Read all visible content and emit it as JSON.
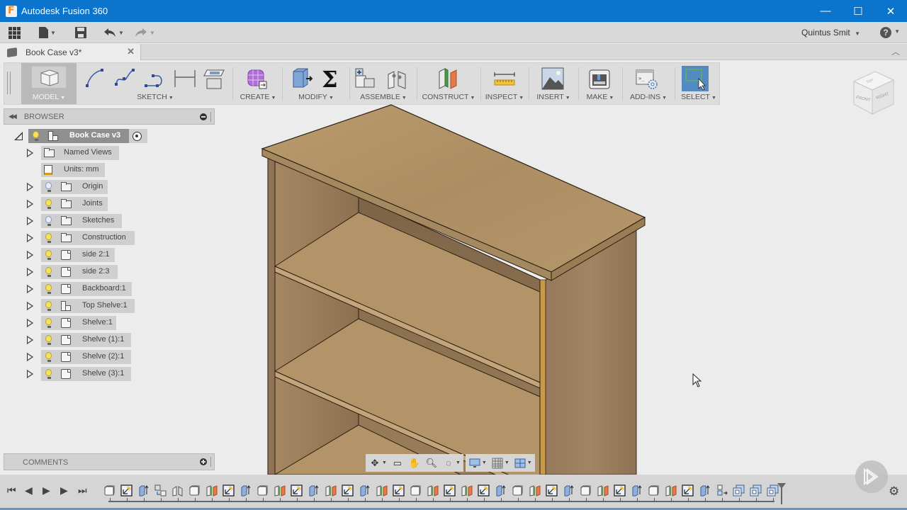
{
  "window": {
    "app_title": "Autodesk Fusion 360",
    "controls": {
      "minimize": "—",
      "maximize": "☐",
      "close": "✕"
    }
  },
  "quick_access": {
    "icons": [
      "apps-grid-icon",
      "file-icon",
      "save-icon",
      "undo-icon",
      "redo-icon"
    ],
    "user_name": "Quintus Smit",
    "help_glyph": "?"
  },
  "document_tab": {
    "label": "Book Case v3*",
    "close_glyph": "✕"
  },
  "ribbon": {
    "workspace": "MODEL",
    "groups": [
      {
        "label": "SKETCH",
        "tools": [
          "arc-icon",
          "spline-icon",
          "line-icon",
          "dimension-icon",
          "stop-sketch-icon"
        ]
      },
      {
        "label": "CREATE",
        "tools": [
          "create-form-icon"
        ]
      },
      {
        "label": "MODIFY",
        "tools": [
          "press-pull-icon",
          "parameters-icon"
        ]
      },
      {
        "label": "ASSEMBLE",
        "tools": [
          "new-component-icon",
          "joint-icon"
        ]
      },
      {
        "label": "CONSTRUCT",
        "tools": [
          "offset-plane-icon"
        ]
      },
      {
        "label": "INSPECT",
        "tools": [
          "measure-icon"
        ]
      },
      {
        "label": "INSERT",
        "tools": [
          "insert-image-icon"
        ]
      },
      {
        "label": "MAKE",
        "tools": [
          "3d-print-icon"
        ]
      },
      {
        "label": "ADD-INS",
        "tools": [
          "scripts-icon"
        ]
      },
      {
        "label": "SELECT",
        "tools": [
          "window-select-icon"
        ]
      }
    ],
    "caret": "▼"
  },
  "browser": {
    "title": "BROWSER",
    "root": "Book Case v3",
    "items": [
      {
        "label": "Named Views",
        "icon": "folder",
        "bulb": "none",
        "expandable": true
      },
      {
        "label": "Units: mm",
        "icon": "units",
        "bulb": "none",
        "expandable": false
      },
      {
        "label": "Origin",
        "icon": "folder",
        "bulb": "off",
        "expandable": true
      },
      {
        "label": "Joints",
        "icon": "folder",
        "bulb": "on",
        "expandable": true
      },
      {
        "label": "Sketches",
        "icon": "folder",
        "bulb": "off",
        "expandable": true
      },
      {
        "label": "Construction",
        "icon": "folder",
        "bulb": "on",
        "expandable": true
      },
      {
        "label": "side 2:1",
        "icon": "body",
        "bulb": "on",
        "expandable": true
      },
      {
        "label": "side 2:3",
        "icon": "body",
        "bulb": "on",
        "expandable": true
      },
      {
        "label": "Backboard:1",
        "icon": "body",
        "bulb": "on",
        "expandable": true
      },
      {
        "label": "Top Shelve:1",
        "icon": "component",
        "bulb": "on",
        "expandable": true
      },
      {
        "label": "Shelve:1",
        "icon": "body",
        "bulb": "on",
        "expandable": true
      },
      {
        "label": "Shelve (1):1",
        "icon": "body",
        "bulb": "on",
        "expandable": true
      },
      {
        "label": "Shelve (2):1",
        "icon": "body",
        "bulb": "on",
        "expandable": true
      },
      {
        "label": "Shelve (3):1",
        "icon": "body",
        "bulb": "on",
        "expandable": true
      }
    ]
  },
  "comments": {
    "title": "COMMENTS"
  },
  "viewcube": {
    "top": "TOP",
    "front": "FRONT",
    "right": "RIGHT"
  },
  "nav_bar": {
    "tools": [
      "orbit-icon",
      "look-at-icon",
      "pan-icon",
      "zoom-icon",
      "fit-icon",
      "display-settings-icon",
      "grid-snaps-icon",
      "viewports-icon"
    ]
  },
  "timeline": {
    "controls": [
      "go-to-start",
      "step-back",
      "step-forward",
      "play",
      "go-to-end"
    ],
    "features": [
      "body",
      "sketch",
      "extrude",
      "move",
      "joint",
      "body",
      "plane",
      "sketch",
      "extrude",
      "body",
      "plane",
      "sketch",
      "extrude",
      "plane",
      "sketch",
      "extrude",
      "plane",
      "sketch",
      "body",
      "plane",
      "sketch",
      "plane",
      "sketch",
      "extrude",
      "body",
      "plane",
      "sketch",
      "extrude",
      "body",
      "plane",
      "sketch",
      "extrude",
      "body",
      "plane",
      "sketch",
      "extrude",
      "align",
      "component",
      "component",
      "component"
    ]
  },
  "colors": {
    "title_bar": "#0b74cc",
    "wood_top": "#b8996b",
    "wood_side": "#9a7f5c",
    "select_accent": "#3c7bbf"
  }
}
